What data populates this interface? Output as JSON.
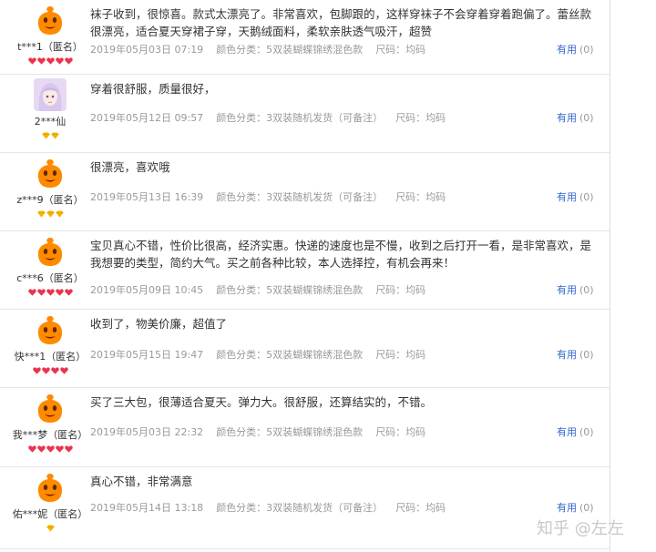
{
  "reviews": [
    {
      "username": "t***1（匿名）",
      "avatar": "orange-mascot",
      "badge_type": "red-heart",
      "badge_count": 5,
      "text": "袜子收到，很惊喜。款式太漂亮了。非常喜欢，包脚跟的，这样穿袜子不会穿着穿着跑偏了。蕾丝款很漂亮，适合夏天穿裙子穿，天鹅绒面料，柔软亲肤透气吸汗，超赞",
      "date": "2019年05月03日 07:19",
      "color_class": "颜色分类：5双装蝴蝶锦绣混色款",
      "size": "尺码：均码",
      "useful_label": "有用",
      "useful_count": "(0)"
    },
    {
      "username": "2***仙",
      "avatar": "anime-girl-photo",
      "badge_type": "gold-diamond",
      "badge_count": 2,
      "text": "穿着很舒服，质量很好，",
      "date": "2019年05月12日 09:57",
      "color_class": "颜色分类：3双装随机发货（可备注）",
      "size": "尺码：均码",
      "useful_label": "有用",
      "useful_count": "(0)"
    },
    {
      "username": "z***9（匿名）",
      "avatar": "orange-mascot",
      "badge_type": "gold-diamond",
      "badge_count": 3,
      "text": "很漂亮，喜欢哦",
      "date": "2019年05月13日 16:39",
      "color_class": "颜色分类：3双装随机发货（可备注）",
      "size": "尺码：均码",
      "useful_label": "有用",
      "useful_count": "(0)"
    },
    {
      "username": "c***6（匿名）",
      "avatar": "orange-mascot",
      "badge_type": "red-heart",
      "badge_count": 5,
      "text": "宝贝真心不错，性价比很高，经济实惠。快递的速度也是不慢，收到之后打开一看，是非常喜欢，是我想要的类型，简约大气。买之前各种比较，本人选择控，有机会再来！",
      "date": "2019年05月09日 10:45",
      "color_class": "颜色分类：5双装蝴蝶锦绣混色款",
      "size": "尺码：均码",
      "useful_label": "有用",
      "useful_count": "(0)"
    },
    {
      "username": "快***1（匿名）",
      "avatar": "orange-mascot",
      "badge_type": "red-heart",
      "badge_count": 4,
      "text": "收到了，物美价廉，超值了",
      "date": "2019年05月15日 19:47",
      "color_class": "颜色分类：5双装蝴蝶锦绣混色款",
      "size": "尺码：均码",
      "useful_label": "有用",
      "useful_count": "(0)"
    },
    {
      "username": "我***梦（匿名）",
      "avatar": "orange-mascot",
      "badge_type": "red-heart",
      "badge_count": 5,
      "text": "买了三大包，很薄适合夏天。弹力大。很舒服，还算结实的，不错。",
      "date": "2019年05月03日 22:32",
      "color_class": "颜色分类：5双装蝴蝶锦绣混色款",
      "size": "尺码：均码",
      "useful_label": "有用",
      "useful_count": "(0)"
    },
    {
      "username": "佑***妮（匿名）",
      "avatar": "orange-mascot",
      "badge_type": "gold-diamond",
      "badge_count": 1,
      "text": "真心不错，非常满意",
      "date": "2019年05月14日 13:18",
      "color_class": "颜色分类：3双装随机发货（可备注）",
      "size": "尺码：均码",
      "useful_label": "有用",
      "useful_count": "(0)"
    }
  ],
  "watermark": "知乎 @左左",
  "colors": {
    "link": "#3366cc",
    "meta": "#9a9a9a",
    "mascot": "#ff8a00",
    "red_heart": "#e8344e",
    "gold_diamond": "#f5b400"
  }
}
